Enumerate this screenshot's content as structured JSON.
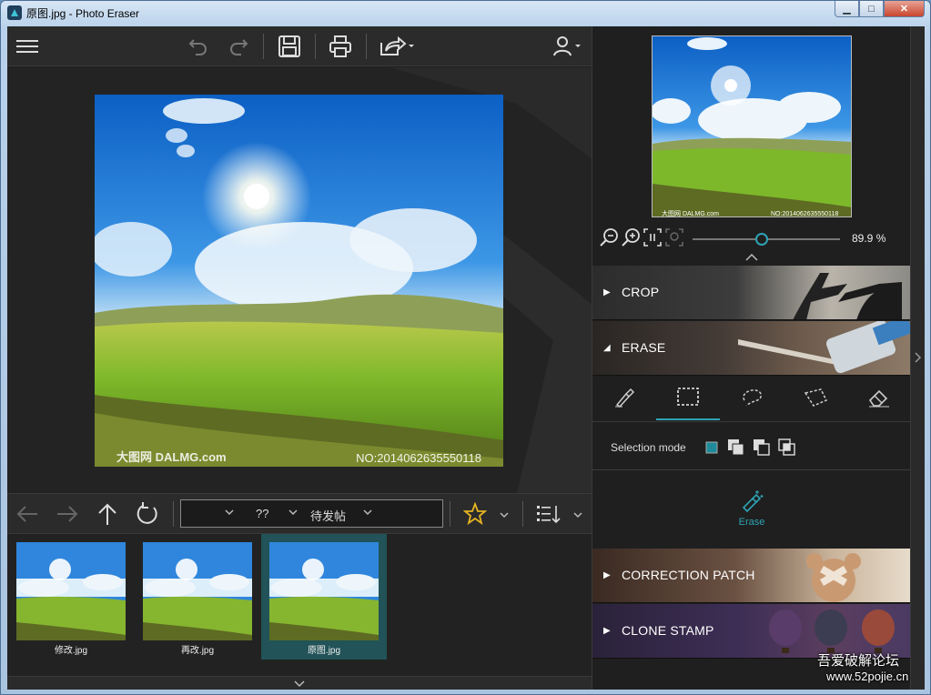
{
  "window": {
    "title": "原图.jpg - Photo Eraser",
    "min_label": "▁",
    "max_label": "□",
    "close_label": "✕"
  },
  "toolbar": {
    "icons": [
      "menu-icon",
      "undo-icon",
      "redo-icon",
      "save-icon",
      "print-icon",
      "share-icon",
      "user-icon"
    ]
  },
  "viewer": {
    "watermark_left": "大图网 DALMG.com",
    "watermark_right": "NO:2014062635550118"
  },
  "preview": {
    "watermark_left": "大图网 DALMG.com",
    "watermark_right": "NO:2014062635550118"
  },
  "navbar": {
    "path_segments": [
      "??",
      "待发帖"
    ]
  },
  "filmstrip": [
    {
      "caption": "修改.jpg",
      "selected": false
    },
    {
      "caption": "再改.jpg",
      "selected": false
    },
    {
      "caption": "原图.jpg",
      "selected": true
    }
  ],
  "zoom": {
    "value_label": "89.9 %",
    "value_percent": 89.9
  },
  "sections": {
    "crop": {
      "label": "CROP",
      "expanded": false
    },
    "erase": {
      "label": "ERASE",
      "expanded": true
    },
    "correction": {
      "label": "CORRECTION PATCH",
      "expanded": false
    },
    "clone": {
      "label": "CLONE STAMP",
      "expanded": false
    }
  },
  "erase_panel": {
    "tools": [
      "brush-icon",
      "rect-select-icon",
      "lasso-icon",
      "polygon-lasso-icon",
      "eraser-icon"
    ],
    "active_tool_index": 1,
    "selection_mode_label": "Selection mode",
    "erase_button_label": "Erase"
  },
  "colors": {
    "accent": "#2ea3b5",
    "panel": "#1f1f1f",
    "toolbar": "#2b2b2b"
  },
  "site_watermark": {
    "line1": "吾爱破解论坛",
    "line2": "www.52pojie.cn"
  }
}
